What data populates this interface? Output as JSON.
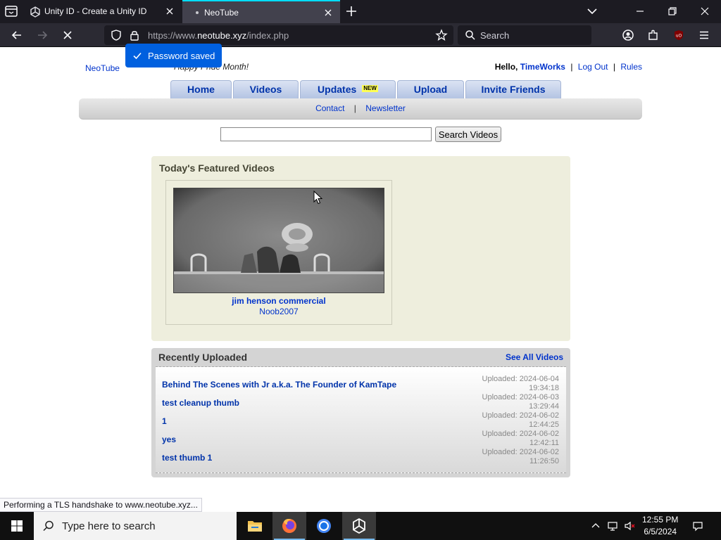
{
  "browser": {
    "tabs": [
      {
        "title": "Unity ID - Create a Unity ID",
        "active": false,
        "icon": "unity-icon"
      },
      {
        "title": "NeoTube",
        "active": true,
        "icon": "loading-dot"
      }
    ],
    "url_prefix": "https://www.",
    "url_domain": "neotube.xyz",
    "url_path": "/index.php",
    "search_placeholder": "Search",
    "toast": "Password saved",
    "status_text": "Performing a TLS handshake to www.neotube.xyz..."
  },
  "site": {
    "logo": "NeoTube",
    "slogan": "Happy Pride Month!",
    "user": {
      "hello": "Hello,",
      "username": "TimeWorks",
      "logout": "Log Out",
      "rules": "Rules",
      "separator": "|"
    },
    "nav": [
      {
        "label": "Home"
      },
      {
        "label": "Videos"
      },
      {
        "label": "Updates",
        "badge": "NEW"
      },
      {
        "label": "Upload"
      },
      {
        "label": "Invite Friends"
      }
    ],
    "subnav": {
      "contact": "Contact",
      "separator": "|",
      "newsletter": "Newsletter"
    },
    "search": {
      "value": "",
      "button": "Search Videos"
    },
    "featured": {
      "title": "Today's Featured Videos",
      "videos": [
        {
          "title": "jim henson commercial",
          "user": "Noob2007"
        }
      ]
    },
    "recent": {
      "title": "Recently Uploaded",
      "see_all": "See All Videos",
      "items": [
        {
          "title": "Behind The Scenes with Jr a.k.a. The Founder of KamTape",
          "uploaded": "Uploaded: 2024-06-04",
          "time": "19:34:18"
        },
        {
          "title": "test cleanup thumb",
          "uploaded": "Uploaded: 2024-06-03",
          "time": "13:29:44"
        },
        {
          "title": "1",
          "uploaded": "Uploaded: 2024-06-02",
          "time": "12:44:25"
        },
        {
          "title": "yes",
          "uploaded": "Uploaded: 2024-06-02",
          "time": "12:42:11"
        },
        {
          "title": "test thumb 1",
          "uploaded": "Uploaded: 2024-06-02",
          "time": "11:26:50"
        }
      ]
    }
  },
  "taskbar": {
    "search_placeholder": "Type here to search",
    "apps": [
      "file-explorer-icon",
      "firefox-icon",
      "chrome-icon",
      "unity-icon"
    ],
    "time": "12:55 PM",
    "date": "6/5/2024"
  },
  "colors": {
    "link": "#0033cc",
    "toast": "#0060df",
    "tab_accent": "#00ddff",
    "featured_bg": "#eeeedd"
  }
}
